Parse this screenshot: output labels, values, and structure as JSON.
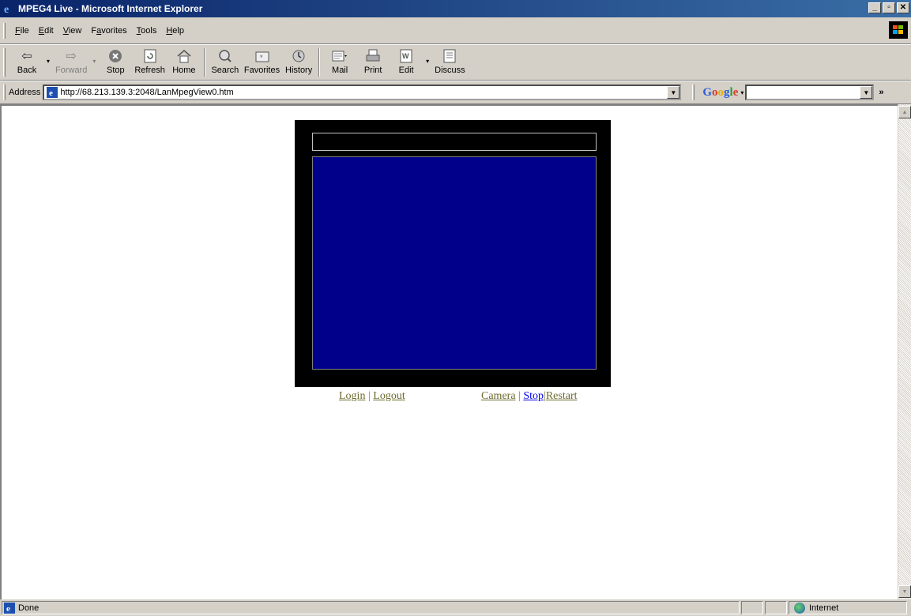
{
  "window": {
    "title": "MPEG4 Live - Microsoft Internet Explorer",
    "controls": [
      "_",
      "▫",
      "✕"
    ]
  },
  "menu": {
    "items": [
      {
        "acc": "F",
        "rest": "ile"
      },
      {
        "acc": "E",
        "rest": "dit"
      },
      {
        "acc": "V",
        "rest": "iew"
      },
      {
        "pre": "F",
        "acc": "a",
        "rest": "vorites"
      },
      {
        "acc": "T",
        "rest": "ools"
      },
      {
        "acc": "H",
        "rest": "elp"
      }
    ]
  },
  "toolbar": {
    "back": "Back",
    "forward": "Forward",
    "stop": "Stop",
    "refresh": "Refresh",
    "home": "Home",
    "search": "Search",
    "favorites": "Favorites",
    "history": "History",
    "mail": "Mail",
    "print": "Print",
    "edit": "Edit",
    "discuss": "Discuss"
  },
  "address": {
    "label": "Address",
    "url": "http://68.213.139.3:2048/LanMpegView0.htm"
  },
  "google": {
    "logo": "Google",
    "query": ""
  },
  "page": {
    "links_left": {
      "login": "Login",
      "sep1": "|",
      "logout": "Logout"
    },
    "links_right": {
      "camera": "Camera",
      "sep1": "|",
      "stop": "Stop",
      "sep2": "|",
      "restart": "Restart"
    },
    "colors": {
      "video_bg": "#00008b",
      "frame": "#000000",
      "link": "#6b6b2e",
      "active_link": "#0000ee"
    }
  },
  "status": {
    "text": "Done",
    "zone": "Internet"
  }
}
